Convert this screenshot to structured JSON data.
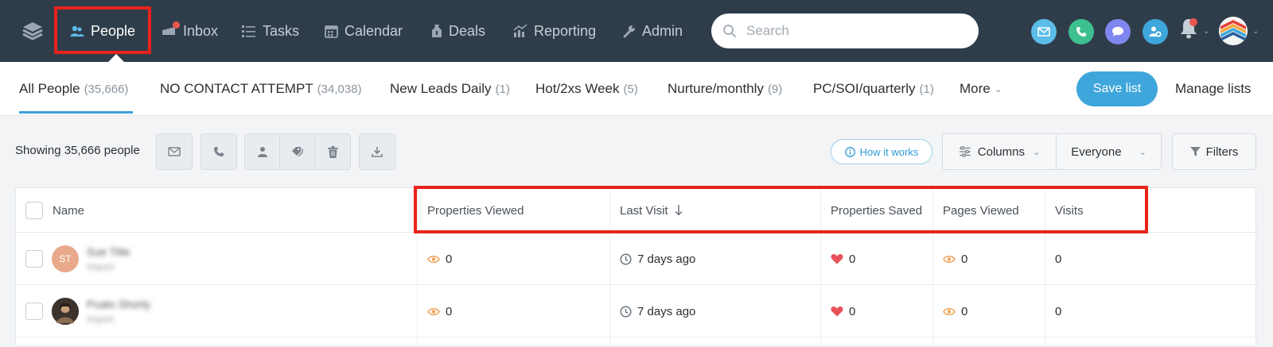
{
  "nav": {
    "items": [
      {
        "label": "People",
        "icon": "people-icon",
        "active": true
      },
      {
        "label": "Inbox",
        "icon": "inbox-icon"
      },
      {
        "label": "Tasks",
        "icon": "tasks-icon"
      },
      {
        "label": "Calendar",
        "icon": "calendar-icon"
      },
      {
        "label": "Deals",
        "icon": "deals-icon"
      },
      {
        "label": "Reporting",
        "icon": "reporting-icon"
      },
      {
        "label": "Admin",
        "icon": "admin-icon"
      }
    ],
    "search_placeholder": "Search",
    "quick_actions": [
      {
        "name": "email-action",
        "color": "#5bbde8"
      },
      {
        "name": "call-action",
        "color": "#3dbf8f"
      },
      {
        "name": "message-action",
        "color": "#7f86f0"
      },
      {
        "name": "add-person-action",
        "color": "#3fa6db"
      }
    ]
  },
  "tabs": [
    {
      "label": "All People",
      "count": "(35,666)",
      "active": true
    },
    {
      "label": "NO CONTACT ATTEMPT",
      "count": "(34,038)"
    },
    {
      "label": "New Leads Daily",
      "count": "(1)"
    },
    {
      "label": "Hot/2xs Week",
      "count": "(5)"
    },
    {
      "label": "Nurture/monthly",
      "count": "(9)"
    },
    {
      "label": "PC/SOI/quarterly",
      "count": "(1)"
    },
    {
      "label": "More",
      "count": ""
    }
  ],
  "save_list_label": "Save list",
  "manage_lists_label": "Manage lists",
  "toolbar": {
    "showing": "Showing 35,666 people",
    "how_it_works": "How it works",
    "columns": "Columns",
    "everyone": "Everyone",
    "filters": "Filters"
  },
  "table": {
    "headers": [
      "Name",
      "Properties Viewed",
      "Last Visit",
      "Properties Saved",
      "Pages Viewed",
      "Visits"
    ],
    "rows": [
      {
        "initials": "ST",
        "avatar_color": "#e8a98c",
        "name": "Sue Title",
        "source": "Import",
        "properties_viewed": "0",
        "last_visit": "7 days ago",
        "properties_saved": "0",
        "pages_viewed": "0",
        "visits": "0"
      },
      {
        "initials": "",
        "avatar_color": "#4a4138",
        "name": "Pualo Shorty",
        "source": "Import",
        "properties_viewed": "0",
        "last_visit": "7 days ago",
        "properties_saved": "0",
        "pages_viewed": "0",
        "visits": "0"
      }
    ]
  },
  "colors": {
    "nav_bg": "#2f3d4a",
    "accent": "#3fa6db",
    "highlight": "#e8231c",
    "eye": "#f0a35a",
    "heart": "#e8535b"
  }
}
